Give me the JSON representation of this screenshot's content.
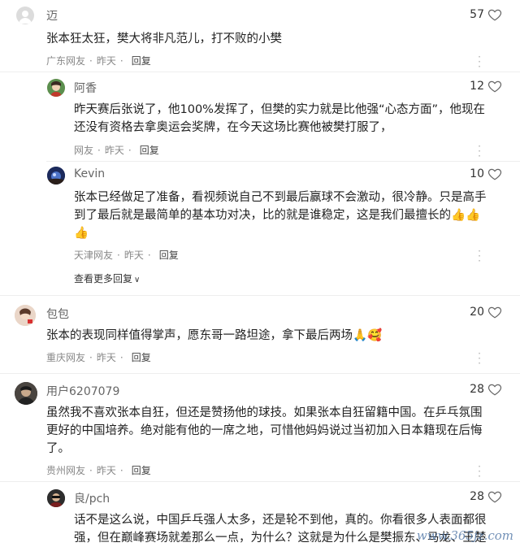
{
  "comments": [
    {
      "username": "迈",
      "likes": "57",
      "text": "张本狂太狂，樊大将非凡范儿，打不败的小樊",
      "region": "广东网友",
      "time": "昨天",
      "reply": "回复"
    },
    {
      "username": "阿香",
      "likes": "12",
      "text": "昨天赛后张说了，他100%发挥了，但樊的实力就是比他强“心态方面”，他现在\n还没有资格去拿奥运会奖牌，在今天这场比赛他被樊打服了，",
      "region": "网友",
      "time": "昨天",
      "reply": "回复"
    },
    {
      "username": "Kevin",
      "likes": "10",
      "text": "张本已经做足了准备，看视频说自己不到最后赢球不会激动，很冷静。只是高手\n到了最后就是最简单的基本功对决，比的就是谁稳定，这是我们最擅长的👍👍\n👍",
      "region": "天津网友",
      "time": "昨天",
      "reply": "回复"
    },
    {
      "username": "包包",
      "likes": "20",
      "text": "张本的表现同样值得掌声，愿东哥一路坦途，拿下最后两场🙏🥰",
      "region": "重庆网友",
      "time": "昨天",
      "reply": "回复"
    },
    {
      "username": "用户6207079",
      "likes": "28",
      "text": "虽然我不喜欢张本自狂，但还是赞扬他的球技。如果张本自狂留籍中国。在乒乓氛围\n更好的中国培养。绝对能有他的一席之地，可惜他妈妈说过当初加入日本籍现在后悔\n了。",
      "region": "贵州网友",
      "time": "昨天",
      "reply": "回复"
    },
    {
      "username": "良/pch",
      "likes": "28",
      "text": "话不是这么说，中国乒乓强人太多，还是轮不到他，真的。你看很多人表面都很\n强，但在巅峰赛场就差那么一点，为什么？这就是为什么是樊振东、马龙、王楚",
      "region": "",
      "time": "",
      "reply": ""
    }
  ],
  "view_more": "查看更多回复",
  "watermark": "www.365jz.com",
  "colors": {
    "heart": "#666666",
    "meta": "#888888",
    "username": "#666666"
  }
}
